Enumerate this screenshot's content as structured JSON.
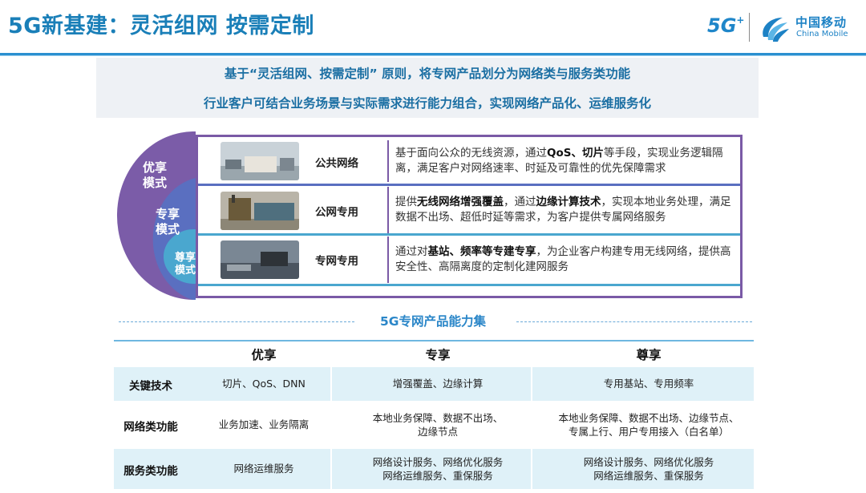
{
  "header": {
    "title": "5G新基建：灵活组网 按需定制",
    "logo_5g": "5G",
    "logo_cn": "中国移动",
    "logo_en": "China Mobile"
  },
  "intro": {
    "line1": "基于“灵活组网、按需定制” 原则，将专网产品划分为网络类与服务类功能",
    "line2": "行业客户可结合业务场景与实际需求进行能力组合，实现网络产品化、运维服务化"
  },
  "modes": {
    "outer": "优享\n模式",
    "middle": "专享\n模式",
    "inner": "尊享\n模式",
    "colors": {
      "outer": "#7b5ca8",
      "middle": "#5a6fc0",
      "inner": "#4aa7cf"
    }
  },
  "rows": [
    {
      "name": "公共网络",
      "desc_parts": [
        {
          "t": "基于面向公众的无线资源，通过",
          "b": false
        },
        {
          "t": "QoS、切片",
          "b": true
        },
        {
          "t": "等手段，实现业务逻辑隔离，满足客户对网络速率、时延及可靠性的优先保障需求",
          "b": false
        }
      ]
    },
    {
      "name": "公网专用",
      "desc_parts": [
        {
          "t": "提供",
          "b": false
        },
        {
          "t": "无线网络增强覆盖",
          "b": true
        },
        {
          "t": "，通过",
          "b": false
        },
        {
          "t": "边缘计算技术",
          "b": true
        },
        {
          "t": "，实现本地业务处理，满足数据不出场、超低时延等需求，为客户提供专属网络服务",
          "b": false
        }
      ]
    },
    {
      "name": "专网专用",
      "desc_parts": [
        {
          "t": "通过对",
          "b": false
        },
        {
          "t": "基站、频率等专建专享",
          "b": true
        },
        {
          "t": "，为企业客户构建专用无线网络，提供高安全性、高隔离度的定制化建网服务",
          "b": false
        }
      ]
    }
  ],
  "capability": {
    "title": "5G专网产品能力集",
    "headers": [
      "优享",
      "专享",
      "尊享"
    ],
    "rows": [
      {
        "label": "关键技术",
        "cells": [
          "切片、QoS、DNN",
          "增强覆盖、边缘计算",
          "专用基站、专用频率"
        ]
      },
      {
        "label": "网络类功能",
        "cells": [
          "业务加速、业务隔离",
          "本地业务保障、数据不出场、\n边缘节点",
          "本地业务保障、数据不出场、边缘节点、\n专属上行、用户专用接入（白名单）"
        ]
      },
      {
        "label": "服务类功能",
        "cells": [
          "网络运维服务",
          "网络设计服务、网络优化服务\n网络运维服务、重保服务",
          "网络设计服务、网络优化服务\n网络运维服务、重保服务"
        ]
      }
    ]
  }
}
